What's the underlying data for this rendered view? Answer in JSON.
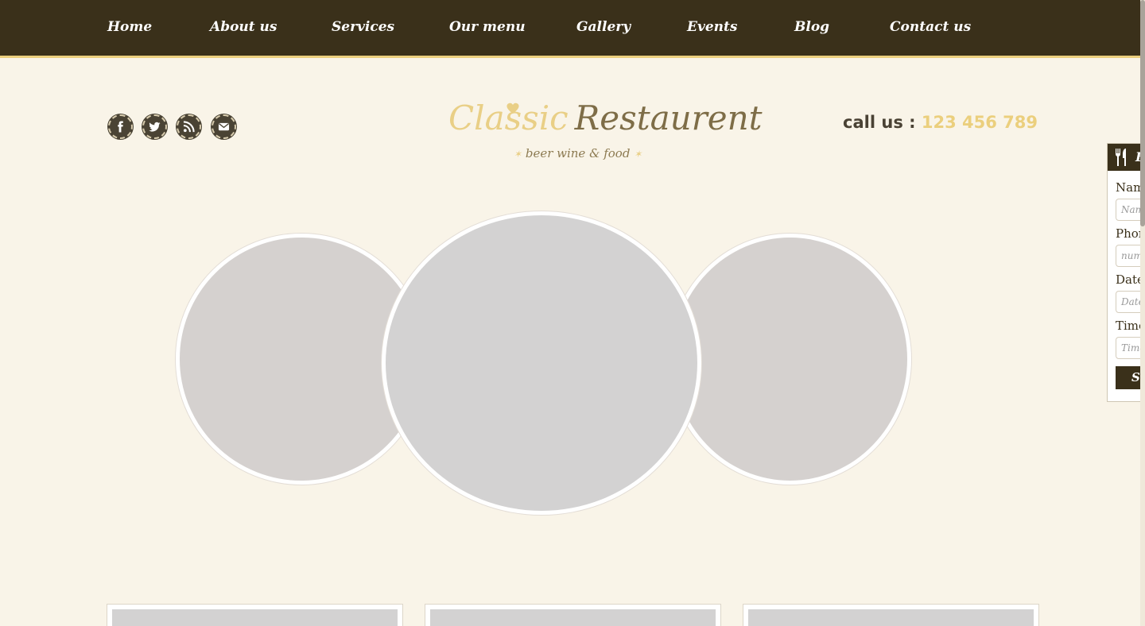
{
  "nav": {
    "items": [
      "Home",
      "About us",
      "Services",
      "Our menu",
      "Gallery",
      "Events",
      "Blog",
      "Contact us"
    ]
  },
  "social": {
    "icons": [
      "facebook-icon",
      "twitter-icon",
      "rss-icon",
      "email-icon"
    ]
  },
  "logo": {
    "classic": "Classic",
    "restaurent": "Restaurent",
    "tagline": "beer wine & food",
    "star": "✶"
  },
  "contact": {
    "label": "call us :",
    "phone": "123 456 789"
  },
  "booking": {
    "title": "Bo",
    "name_label": "Name",
    "name_placeholder": "Name",
    "phone_label": "Phone",
    "phone_placeholder": "numb",
    "date_label": "Date",
    "date_placeholder": "Date",
    "time_label": "Time",
    "time_placeholder": "Time",
    "send_label": "Se"
  },
  "colors": {
    "nav_bg": "#3a301a",
    "accent_gold": "#ebcf7d",
    "page_bg": "#f9f4e8",
    "placeholder_gray": "#d3d2d2"
  }
}
